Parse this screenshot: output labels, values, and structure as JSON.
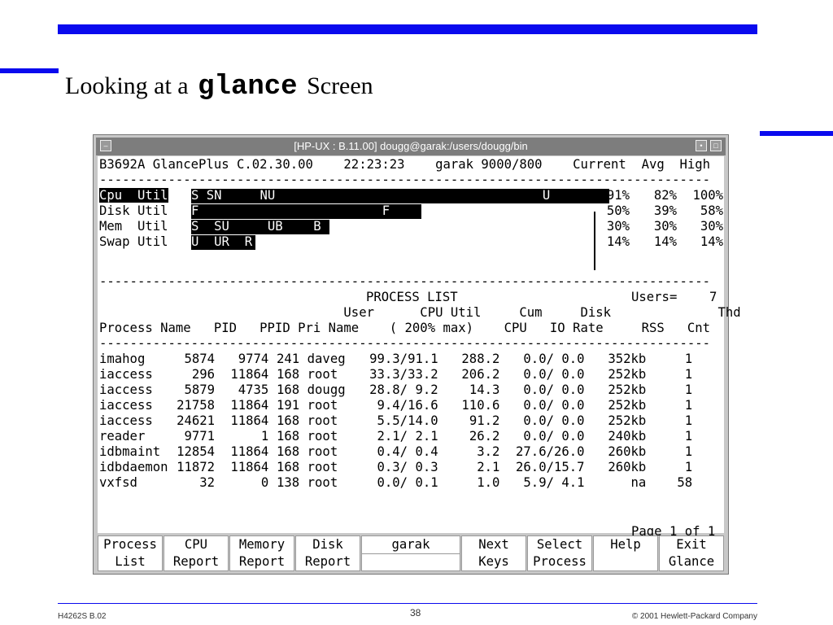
{
  "slide": {
    "title_prefix": "Looking at a",
    "title_command": "glance",
    "title_suffix": "Screen",
    "footer_left": "H4262S B.02",
    "page_number": "38",
    "footer_right": "© 2001 Hewlett-Packard Company"
  },
  "window": {
    "title": "[HP-UX : B.11.00] dougg@garak:/users/dougg/bin",
    "menu_icon": "minus-icon",
    "minimize_icon": "dot-icon",
    "maximize_icon": "square-icon"
  },
  "header_line": "B3692A GlancePlus C.02.30.00    22:23:23    garak 9000/800    Current  Avg  High",
  "separator": "--------------------------------------------------------------------------------",
  "util": [
    {
      "label": "Cpu  Util",
      "bar_text": "S SN     NU                                   U",
      "fill_pct": 91,
      "current": "91%",
      "avg": "82%",
      "high": "100%"
    },
    {
      "label": "Disk Util",
      "bar_text": "F                        F",
      "fill_pct": 50,
      "current": "50%",
      "avg": "39%",
      "high": "58%"
    },
    {
      "label": "Mem  Util",
      "bar_text": "S  SU     UB    B",
      "fill_pct": 30,
      "current": "30%",
      "avg": "30%",
      "high": "30%"
    },
    {
      "label": "Swap Util",
      "bar_text": "U  UR  R",
      "fill_pct": 14,
      "current": "14%",
      "avg": "14%",
      "high": "14%"
    }
  ],
  "process_list": {
    "title": "PROCESS LIST",
    "users_label": "Users=",
    "users_value": "7",
    "header_line1": "                                User      CPU Util     Cum     Disk              Thd",
    "header_line2": "Process Name   PID   PPID Pri Name    ( 200% max)    CPU   IO Rate     RSS   Cnt",
    "rows": [
      {
        "name": "imahog",
        "pid": "5874",
        "ppid": "9774",
        "pri": "241",
        "user": "daveg",
        "cpu": "99.3/91.1",
        "cum": "288.2",
        "io": "0.0/ 0.0",
        "rss": "352kb",
        "thd": "1"
      },
      {
        "name": "iaccess",
        "pid": "296",
        "ppid": "11864",
        "pri": "168",
        "user": "root",
        "cpu": "33.3/33.2",
        "cum": "206.2",
        "io": "0.0/ 0.0",
        "rss": "252kb",
        "thd": "1"
      },
      {
        "name": "iaccess",
        "pid": "5879",
        "ppid": "4735",
        "pri": "168",
        "user": "dougg",
        "cpu": "28.8/ 9.2",
        "cum": "14.3",
        "io": "0.0/ 0.0",
        "rss": "252kb",
        "thd": "1"
      },
      {
        "name": "iaccess",
        "pid": "21758",
        "ppid": "11864",
        "pri": "191",
        "user": "root",
        "cpu": "9.4/16.6",
        "cum": "110.6",
        "io": "0.0/ 0.0",
        "rss": "252kb",
        "thd": "1"
      },
      {
        "name": "iaccess",
        "pid": "24621",
        "ppid": "11864",
        "pri": "168",
        "user": "root",
        "cpu": "5.5/14.0",
        "cum": "91.2",
        "io": "0.0/ 0.0",
        "rss": "252kb",
        "thd": "1"
      },
      {
        "name": "reader",
        "pid": "9771",
        "ppid": "1",
        "pri": "168",
        "user": "root",
        "cpu": "2.1/ 2.1",
        "cum": "26.2",
        "io": "0.0/ 0.0",
        "rss": "240kb",
        "thd": "1"
      },
      {
        "name": "idbmaint",
        "pid": "12854",
        "ppid": "11864",
        "pri": "168",
        "user": "root",
        "cpu": "0.4/ 0.4",
        "cum": "3.2",
        "io": "27.6/26.0",
        "rss": "260kb",
        "thd": "1"
      },
      {
        "name": "idbdaemon",
        "pid": "11872",
        "ppid": "11864",
        "pri": "168",
        "user": "root",
        "cpu": "0.3/ 0.3",
        "cum": "2.1",
        "io": "26.0/15.7",
        "rss": "260kb",
        "thd": "1"
      },
      {
        "name": "vxfsd",
        "pid": "32",
        "ppid": "0",
        "pri": "138",
        "user": "root",
        "cpu": "0.0/ 0.1",
        "cum": "1.0",
        "io": "5.9/ 4.1",
        "rss": "na",
        "thd": "58"
      }
    ],
    "page_label": "Page 1 of 1"
  },
  "softkeys": [
    {
      "line1": "Process",
      "line2": "List"
    },
    {
      "line1": "CPU",
      "line2": "Report"
    },
    {
      "line1": "Memory",
      "line2": "Report"
    },
    {
      "line1": "Disk",
      "line2": "Report"
    },
    {
      "line1": "garak",
      "line2": ""
    },
    {
      "line1": "Next",
      "line2": "Keys"
    },
    {
      "line1": "Select",
      "line2": "Process"
    },
    {
      "line1": "Help",
      "line2": ""
    },
    {
      "line1": "Exit",
      "line2": "Glance"
    }
  ]
}
